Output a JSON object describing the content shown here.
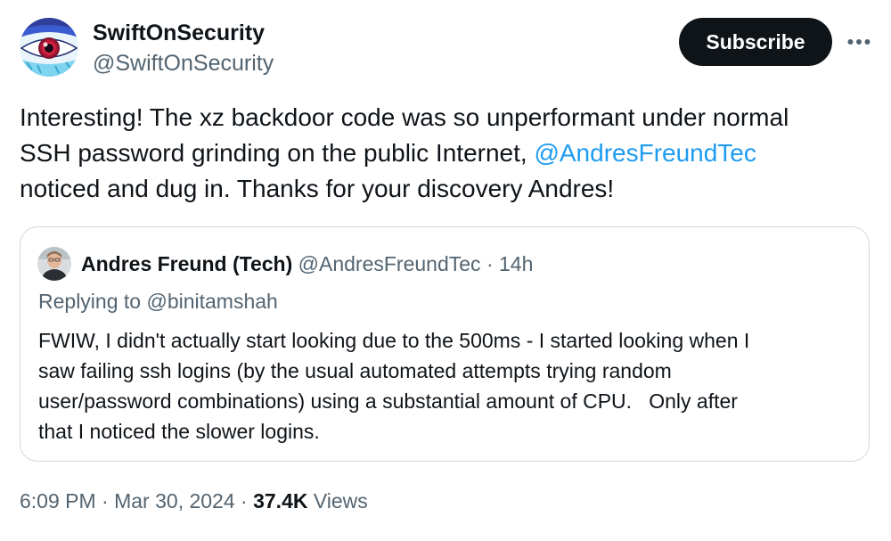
{
  "author": {
    "name": "SwiftOnSecurity",
    "handle": "@SwiftOnSecurity"
  },
  "actions": {
    "subscribe_label": "Subscribe",
    "more_icon": "more-horizontal-icon"
  },
  "tweet": {
    "line1": "Interesting! The xz backdoor code was so unperformant under normal",
    "line2_before": "SSH password grinding on the public Internet, ",
    "line2_mention": "@AndresFreundTec",
    "line3": "noticed and dug in. Thanks for your discovery Andres!"
  },
  "quote": {
    "name": "Andres Freund (Tech)",
    "handle": "@AndresFreundTec",
    "separator": "·",
    "time": "14h",
    "replying_prefix": "Replying to ",
    "replying_to": "@binitamshah",
    "lines": [
      "FWIW, I didn't actually start looking due to the 500ms - I started looking when I",
      "saw failing ssh logins (by the usual automated attempts trying random",
      "user/password combinations) using a substantial amount of CPU.   Only after",
      "that I noticed the slower logins."
    ]
  },
  "footer": {
    "time": "6:09 PM",
    "sep1": "·",
    "date": "Mar 30, 2024",
    "sep2": "·",
    "views_count": "37.4K",
    "views_label": "Views"
  },
  "colors": {
    "link": "#1d9bf0",
    "secondary_text": "#536471",
    "primary_text": "#0f1419",
    "button_bg": "#0f1419",
    "border": "#cfd9de"
  }
}
